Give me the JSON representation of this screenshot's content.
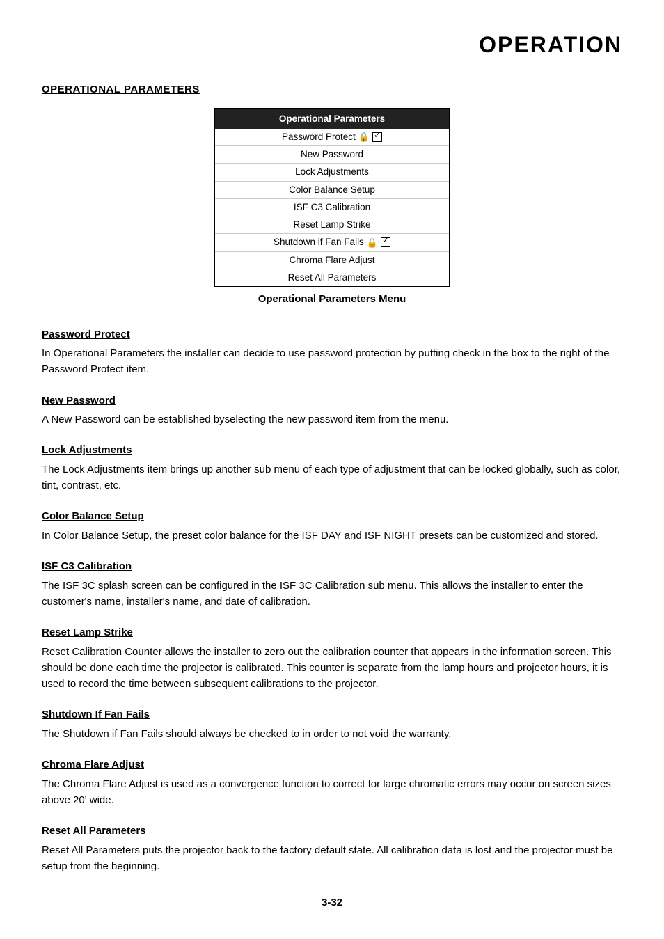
{
  "page": {
    "title": "OPERATION",
    "page_number": "3-32"
  },
  "section_heading": "OPERATIONAL PARAMETERS",
  "table": {
    "header": "Operational Parameters",
    "caption": "Operational Parameters Menu",
    "rows": [
      {
        "text": "Password Protect",
        "has_lock": true,
        "has_checkbox": true,
        "checked": true
      },
      {
        "text": "New Password",
        "has_lock": false,
        "has_checkbox": false,
        "checked": false
      },
      {
        "text": "Lock Adjustments",
        "has_lock": false,
        "has_checkbox": false,
        "checked": false
      },
      {
        "text": "Color Balance Setup",
        "has_lock": false,
        "has_checkbox": false,
        "checked": false
      },
      {
        "text": "ISF C3 Calibration",
        "has_lock": false,
        "has_checkbox": false,
        "checked": false
      },
      {
        "text": "Reset Lamp Strike",
        "has_lock": false,
        "has_checkbox": false,
        "checked": false
      },
      {
        "text": "Shutdown if Fan Fails",
        "has_lock": true,
        "has_checkbox": true,
        "checked": true
      },
      {
        "text": "Chroma Flare Adjust",
        "has_lock": false,
        "has_checkbox": false,
        "checked": false
      },
      {
        "text": "Reset All Parameters",
        "has_lock": false,
        "has_checkbox": false,
        "checked": false
      }
    ]
  },
  "subsections": [
    {
      "id": "password-protect",
      "title": "Password Protect",
      "body": "In Operational Parameters the installer can decide to use password protection by putting check in the box to the right of the Password Protect item."
    },
    {
      "id": "new-password",
      "title": "New Password",
      "body": "A New Password can be established byselecting the new password item from the menu."
    },
    {
      "id": "lock-adjustments",
      "title": "Lock Adjustments",
      "body": "The Lock Adjustments item brings up another sub menu of each type of adjustment that can be locked globally, such as color, tint, contrast, etc."
    },
    {
      "id": "color-balance-setup",
      "title": "Color Balance Setup",
      "body": "In Color Balance Setup, the preset color balance for the ISF DAY and ISF NIGHT presets can be customized and stored."
    },
    {
      "id": "isf-c3-calibration",
      "title": "ISF C3 Calibration",
      "body": "The ISF 3C splash screen can be configured in the ISF 3C Calibration sub menu.  This allows the installer to enter the customer's name, installer's name, and date of calibration."
    },
    {
      "id": "reset-lamp-strike",
      "title": "Reset Lamp Strike",
      "body": "Reset Calibration Counter allows the installer to zero out the calibration counter that appears in the information screen. This should be done each time the projector is calibrated. This counter is separate from the lamp hours and projector hours, it is used to record the time between subsequent calibrations to the projector."
    },
    {
      "id": "shutdown-fan-fails",
      "title": "Shutdown If Fan Fails",
      "body": "The Shutdown if Fan Fails should always be checked to in order to not void the warranty."
    },
    {
      "id": "chroma-flare-adjust",
      "title": "Chroma Flare Adjust",
      "body": "The Chroma Flare Adjust is used as a convergence function to correct for large chromatic errors may occur on screen sizes above 20' wide."
    },
    {
      "id": "reset-all-parameters",
      "title": "Reset All Parameters",
      "body": "Reset All Parameters puts the projector back to the factory default state.  All calibration data is lost and the projector must be setup from the beginning."
    }
  ]
}
